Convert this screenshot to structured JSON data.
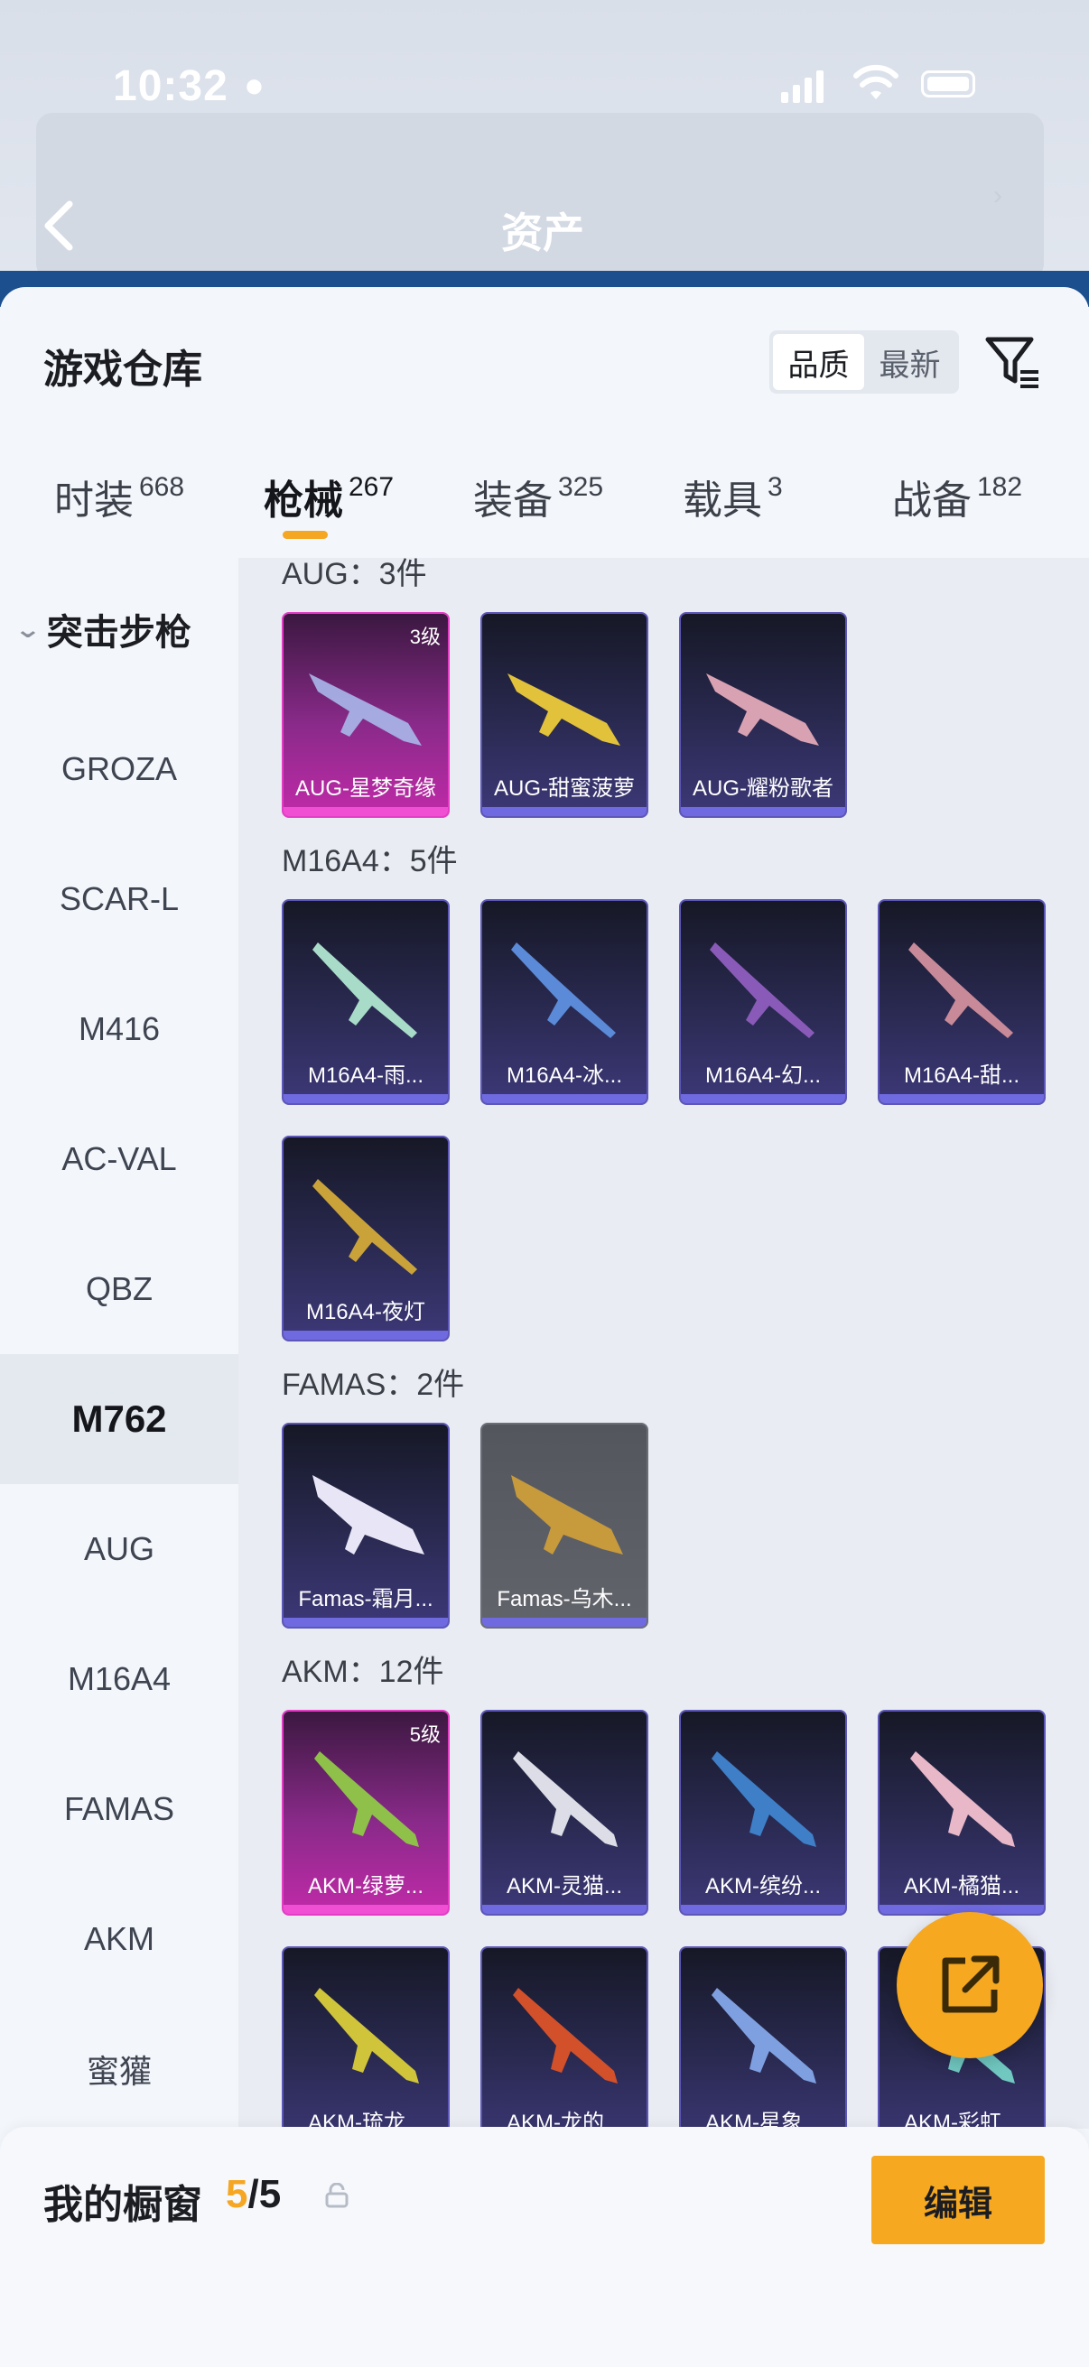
{
  "status_bar": {
    "time": "10:32"
  },
  "background": {
    "title": "资产"
  },
  "sheet": {
    "title": "游戏仓库",
    "sort": {
      "options": [
        "品质",
        "最新"
      ],
      "selected": "品质"
    },
    "tabs": [
      {
        "label": "时装",
        "count": "668"
      },
      {
        "label": "枪械",
        "count": "267"
      },
      {
        "label": "装备",
        "count": "325"
      },
      {
        "label": "载具",
        "count": "3"
      },
      {
        "label": "战备",
        "count": "182"
      }
    ],
    "active_tab": "枪械"
  },
  "sidebar": {
    "group": "突击步枪",
    "items": [
      "GROZA",
      "SCAR-L",
      "M416",
      "AC-VAL",
      "QBZ",
      "M762",
      "AUG",
      "M16A4",
      "FAMAS",
      "AKM",
      "蜜獾"
    ],
    "selected": "M762"
  },
  "groups": [
    {
      "label": "AUG：3件",
      "items": [
        {
          "name": "AUG-星梦奇缘",
          "level": "3级",
          "style": "pink"
        },
        {
          "name": "AUG-甜蜜菠萝",
          "style": "purple"
        },
        {
          "name": "AUG-耀粉歌者",
          "style": "purple"
        }
      ]
    },
    {
      "label": "M16A4：5件",
      "items": [
        {
          "name": "M16A4-雨...",
          "style": "purple"
        },
        {
          "name": "M16A4-冰...",
          "style": "purple"
        },
        {
          "name": "M16A4-幻...",
          "style": "purple"
        },
        {
          "name": "M16A4-甜...",
          "style": "purple"
        },
        {
          "name": "M16A4-夜灯",
          "style": "purple"
        }
      ]
    },
    {
      "label": "FAMAS：2件",
      "items": [
        {
          "name": "Famas-霜月...",
          "style": "purple"
        },
        {
          "name": "Famas-乌木...",
          "style": "gray"
        }
      ]
    },
    {
      "label": "AKM：12件",
      "items": [
        {
          "name": "AKM-绿萝...",
          "level": "5级",
          "style": "pink"
        },
        {
          "name": "AKM-灵猫...",
          "style": "purple"
        },
        {
          "name": "AKM-缤纷...",
          "style": "purple"
        },
        {
          "name": "AKM-橘猫...",
          "style": "purple"
        },
        {
          "name": "AKM-琉龙...",
          "style": "purple"
        },
        {
          "name": "AKM-龙的...",
          "style": "purple"
        },
        {
          "name": "AKM-星象...",
          "style": "purple"
        },
        {
          "name": "AKM-彩虹...",
          "style": "purple"
        }
      ]
    }
  ],
  "footer": {
    "label": "我的橱窗",
    "count_used": "5",
    "count_sep": "/",
    "count_total": "5",
    "edit_label": "编辑"
  },
  "colors": {
    "accent": "#f5a820",
    "sheet_bg": "#f3f6fb",
    "grid_bg": "#e9ecf2",
    "pink_card": "#c02aa8",
    "purple_card": "#3d3878"
  }
}
